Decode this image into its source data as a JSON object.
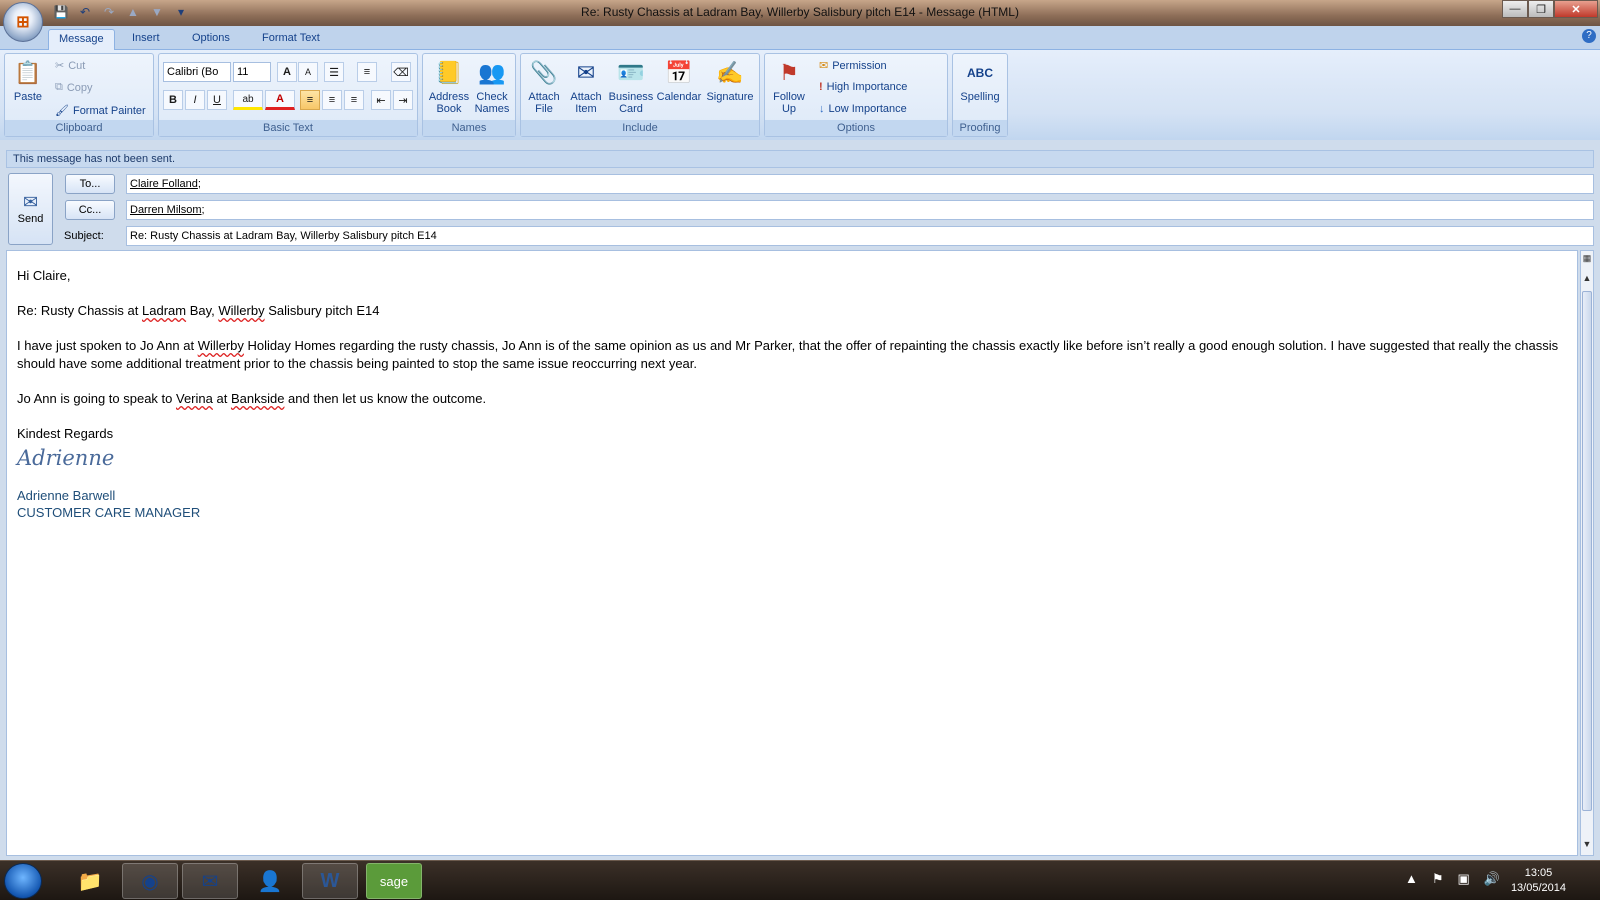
{
  "window": {
    "title": "Re: Rusty Chassis at Ladram Bay, Willerby Salisbury pitch E14 - Message (HTML)",
    "controls": {
      "minimize": "—",
      "maximize": "❐",
      "close": "✕"
    }
  },
  "qat": {
    "save_glyph": "💾",
    "undo_glyph": "↶",
    "redo_glyph": "↷",
    "up_glyph": "▲",
    "down_glyph": "▼",
    "more_glyph": "▾"
  },
  "tabs": [
    "Message",
    "Insert",
    "Options",
    "Format Text"
  ],
  "ribbon": {
    "clipboard": {
      "label": "Clipboard",
      "paste": "Paste",
      "cut": "Cut",
      "copy": "Copy",
      "format_painter": "Format Painter"
    },
    "basic_text": {
      "label": "Basic Text",
      "font": "Calibri (Bo",
      "size": "11",
      "bold": "B",
      "italic": "I",
      "underline": "U",
      "grow": "A",
      "shrink": "A",
      "highlight": "ab",
      "fontcolor": "A"
    },
    "names": {
      "label": "Names",
      "address_book_1": "Address",
      "address_book_2": "Book",
      "check_names_1": "Check",
      "check_names_2": "Names"
    },
    "include": {
      "label": "Include",
      "attach_file_1": "Attach",
      "attach_file_2": "File",
      "attach_item_1": "Attach",
      "attach_item_2": "Item",
      "business_card_1": "Business",
      "business_card_2": "Card",
      "calendar": "Calendar",
      "signature": "Signature"
    },
    "options": {
      "label": "Options",
      "follow_up_1": "Follow",
      "follow_up_2": "Up",
      "permission": "Permission",
      "high_importance": "High Importance",
      "low_importance": "Low Importance"
    },
    "proofing": {
      "label": "Proofing",
      "spelling": "Spelling",
      "abc": "ABC"
    }
  },
  "notice": "This message has not been sent.",
  "header": {
    "send": "Send",
    "to_button": "To...",
    "cc_button": "Cc...",
    "subject_label": "Subject:",
    "to_value": "Claire Folland",
    "cc_value": "Darren Milsom",
    "recipient_sep": ";",
    "subject_value": "Re: Rusty Chassis at Ladram Bay, Willerby Salisbury pitch E14"
  },
  "body": {
    "greeting": "Hi Claire,",
    "subject_line": {
      "a": "Re: Rusty Chassis at ",
      "b": "Ladram",
      "c": " Bay, ",
      "d": "Willerby",
      "e": " Salisbury pitch E14"
    },
    "para1": {
      "a": "I have just spoken to Jo Ann at ",
      "b": "Willerby",
      "c": " Holiday Homes regarding the rusty chassis, Jo Ann is of the same opinion as us and Mr Parker, that the offer of repainting the chassis exactly like before isn’t really a good enough solution.  I have suggested that really the chassis should have some additional treatment prior to the chassis being painted to stop the same issue reoccurring next year."
    },
    "para2": {
      "a": "Jo Ann is going to speak to ",
      "b": "Verina",
      "c": " at ",
      "d": "Bankside",
      "e": " and then let us know the outcome."
    },
    "closing": "Kindest Regards",
    "signature_script": "Adrienne",
    "sig_name": "Adrienne Barwell",
    "sig_title": "CUSTOMER CARE MANAGER"
  },
  "clock": {
    "time": "13:05",
    "date": "13/05/2014"
  }
}
